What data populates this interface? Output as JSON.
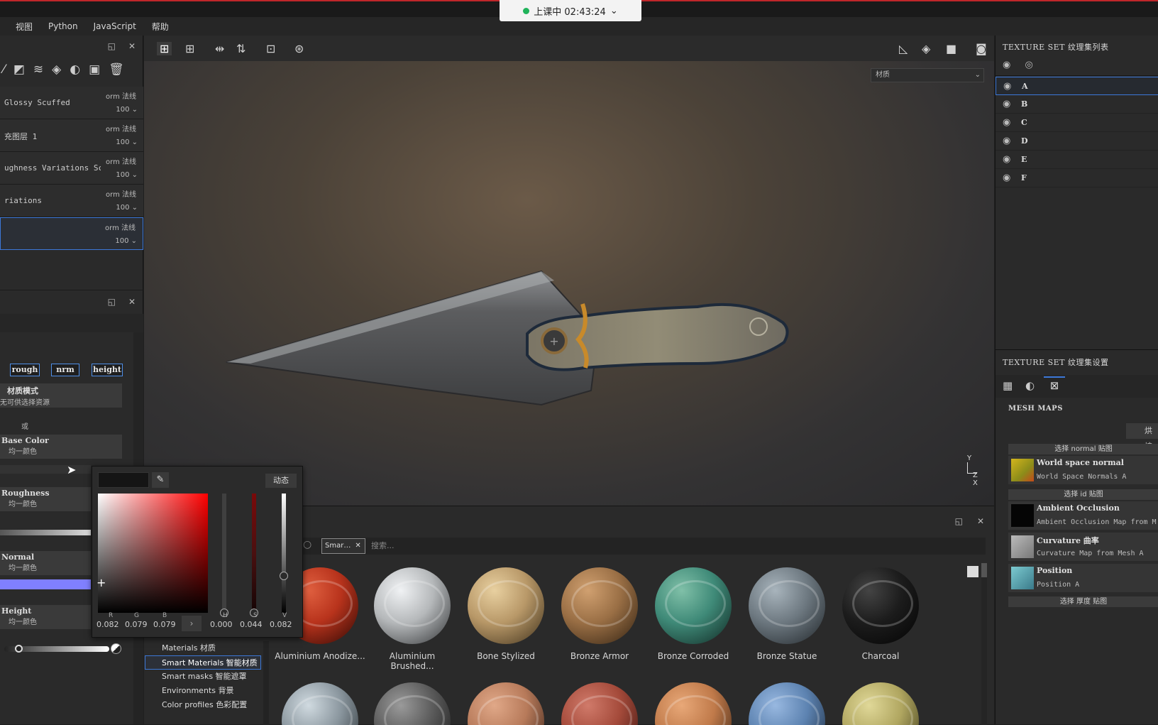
{
  "recording": {
    "label": "上课中 02:43:24"
  },
  "menu": [
    "视图",
    "Python",
    "JavaScript",
    "帮助"
  ],
  "layers": [
    {
      "name": "Glossy Scuffed",
      "blend": "orm 法线",
      "opacity": "100"
    },
    {
      "name": "充图层 1",
      "blend": "orm 法线",
      "opacity": "100"
    },
    {
      "name": "ughness Variations Sc…",
      "blend": "orm 法线",
      "opacity": "100"
    },
    {
      "name": "riations",
      "blend": "orm 法线",
      "opacity": "100"
    },
    {
      "name": "",
      "blend": "orm 法线",
      "opacity": "100"
    }
  ],
  "properties": {
    "channels": [
      "rough",
      "nrm",
      "height"
    ],
    "material_mode_title": "材质模式",
    "material_mode_sub": "无可供选择资源",
    "or_label": "或",
    "base_color_title": "Base Color",
    "base_color_sub": "均一颜色",
    "roughness_title": "Roughness",
    "roughness_sub": "均一颜色",
    "normal_title": "Normal",
    "normal_sub": "均一颜色",
    "height_title": "Height",
    "height_sub": "均一颜色"
  },
  "viewport": {
    "dropdown": "材质",
    "axis_y": "Y",
    "axis_zx": "Z X"
  },
  "texture_set_list": {
    "header": "TEXTURE SET 纹理集列表",
    "items": [
      "A",
      "B",
      "C",
      "D",
      "E",
      "F"
    ],
    "selected": "A"
  },
  "texture_set_settings": {
    "header": "TEXTURE SET 纹理集设置",
    "mesh_maps_label": "MESH MAPS",
    "bake_button": "烘焙",
    "sections": [
      {
        "label": "选择 normal 贴图"
      },
      {
        "label": "选择 id 贴图"
      },
      {
        "label": "选择 厚度 贴图"
      }
    ],
    "maps": [
      {
        "title": "World space normal",
        "sub": "World Space Normals A",
        "color": "#b9a21a"
      },
      {
        "title": "Ambient Occlusion",
        "sub": "Ambient Occlusion Map from M",
        "color": "#050505"
      },
      {
        "title": "Curvature 曲率",
        "sub": "Curvature Map from Mesh A",
        "color": "#9a9a9a"
      },
      {
        "title": "Position",
        "sub": "Position A",
        "color": "#5aa3b0"
      }
    ]
  },
  "shelf": {
    "filter_chip": "Smar…",
    "search_placeholder": "搜索...",
    "categories": [
      "Materials 材质",
      "Smart Materials 智能材质",
      "Smart masks 智能遮罩",
      "Environments 背景",
      "Color profiles 色彩配置"
    ],
    "selected_category": "Smart Materials 智能材质",
    "materials": [
      {
        "name": "Aluminium Anodize...",
        "color": "#b8331c"
      },
      {
        "name": "Aluminium Brushed...",
        "color": "#b5b8ba"
      },
      {
        "name": "Bone Stylized",
        "color": "#b89868"
      },
      {
        "name": "Bronze Armor",
        "color": "#9a6f45"
      },
      {
        "name": "Bronze Corroded",
        "color": "#3f8a78"
      },
      {
        "name": "Bronze Statue",
        "color": "#6d7880"
      },
      {
        "name": "Charcoal",
        "color": "#1c1c1c"
      }
    ],
    "row2_colors": [
      "#8a969e",
      "#5a5a5a",
      "#b77a5a",
      "#a44a3a",
      "#c07a4a",
      "#5c82b0",
      "#b0a660"
    ]
  },
  "color_picker": {
    "mode_button": "动态",
    "labels": [
      "R",
      "G",
      "B",
      "H",
      "S",
      "V"
    ],
    "values": [
      "0.082",
      "0.079",
      "0.079",
      "0.000",
      "0.044",
      "0.082"
    ]
  }
}
